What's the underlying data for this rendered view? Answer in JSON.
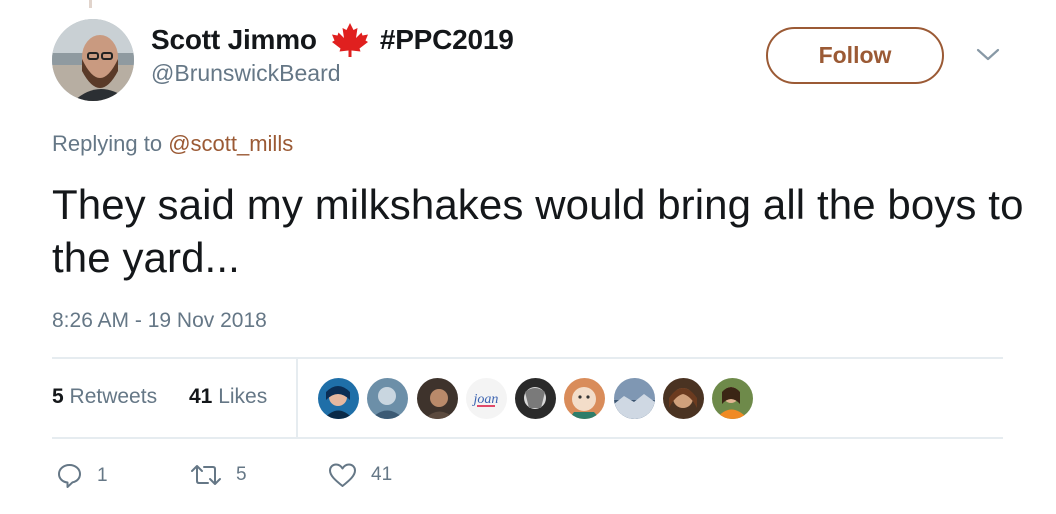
{
  "author": {
    "name": "Scott Jimmo",
    "flag_icon": "maple-leaf-icon",
    "hashtag": "#PPC2019",
    "handle": "@BrunswickBeard"
  },
  "follow_button": {
    "label": "Follow"
  },
  "reply": {
    "prefix": "Replying to ",
    "mention": "@scott_mills"
  },
  "tweet": {
    "text": "They said my milkshakes would bring all the boys to the yard...",
    "timestamp": "8:26 AM - 19 Nov 2018"
  },
  "stats": {
    "retweets_count": "5",
    "retweets_label": "Retweets",
    "likes_count": "41",
    "likes_label": "Likes",
    "liker_avatars": 9
  },
  "actions": {
    "reply_count": "1",
    "retweet_count": "5",
    "like_count": "41"
  },
  "colors": {
    "accent": "#9b5a35",
    "muted": "#657786",
    "text": "#14171a",
    "divider": "#e6ecf0",
    "leaf": "#e0201f"
  }
}
